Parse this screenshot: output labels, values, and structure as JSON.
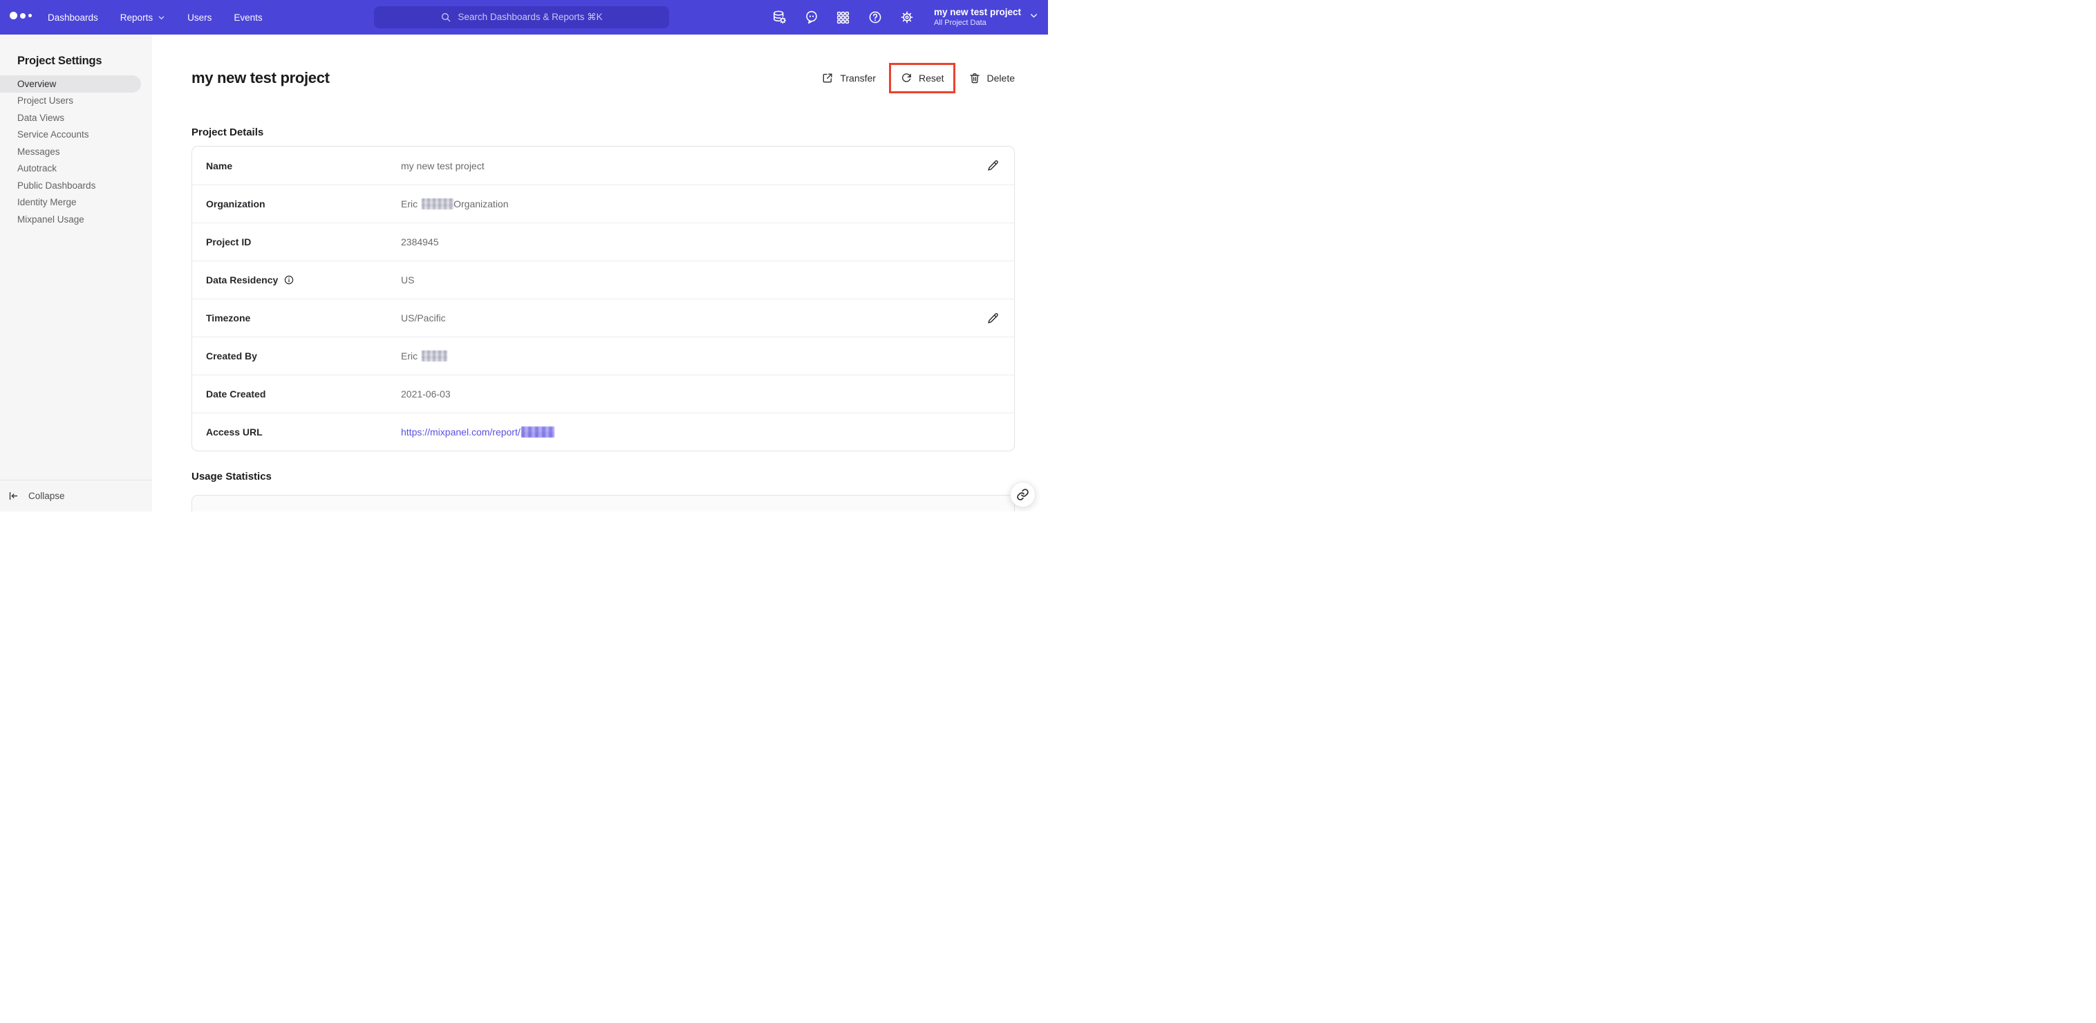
{
  "colors": {
    "nav_background": "#4b44d9",
    "search_background": "#3e37c2",
    "link": "#5a50e0",
    "annotation_red": "#e8432d",
    "sidebar_active_background": "#e5e5e8"
  },
  "nav": {
    "logo": "mixpanel-logo",
    "items": [
      {
        "label": "Dashboards"
      },
      {
        "label": "Reports",
        "chevron": true
      },
      {
        "label": "Users"
      },
      {
        "label": "Events"
      }
    ],
    "search": {
      "placeholder": "Search Dashboards & Reports ⌘K",
      "icon": "search-icon"
    },
    "icon_buttons": [
      {
        "name": "data-management-icon"
      },
      {
        "name": "feedback-icon"
      },
      {
        "name": "apps-grid-icon"
      },
      {
        "name": "help-icon"
      },
      {
        "name": "settings-gear-icon"
      }
    ],
    "project_selector": {
      "name": "my new test project",
      "scope": "All Project Data",
      "chevron": "chevron-down-icon"
    }
  },
  "sidebar": {
    "title": "Project Settings",
    "items": [
      {
        "label": "Overview",
        "active": true
      },
      {
        "label": "Project Users"
      },
      {
        "label": "Data Views"
      },
      {
        "label": "Service Accounts"
      },
      {
        "label": "Messages"
      },
      {
        "label": "Autotrack"
      },
      {
        "label": "Public Dashboards"
      },
      {
        "label": "Identity Merge"
      },
      {
        "label": "Mixpanel Usage"
      }
    ],
    "collapse_label": "Collapse"
  },
  "main": {
    "title": "my new test project",
    "actions": {
      "transfer": {
        "label": "Transfer",
        "icon": "transfer-icon"
      },
      "reset": {
        "label": "Reset",
        "icon": "reset-icon",
        "annotated": true
      },
      "delete": {
        "label": "Delete",
        "icon": "trash-icon"
      }
    },
    "project_details": {
      "title": "Project Details",
      "rows": [
        {
          "label": "Name",
          "value": "my new test project",
          "editable": true
        },
        {
          "label": "Organization",
          "value_prefix": "Eric",
          "value_suffix": "Organization",
          "redacted": true
        },
        {
          "label": "Project ID",
          "value": "2384945"
        },
        {
          "label": "Data Residency",
          "value": "US",
          "info": true
        },
        {
          "label": "Timezone",
          "value": "US/Pacific",
          "editable": true
        },
        {
          "label": "Created By",
          "value_prefix": "Eric",
          "redacted": true
        },
        {
          "label": "Date Created",
          "value": "2021-06-03"
        },
        {
          "label": "Access URL",
          "link_prefix": "https://mixpanel.com/report/",
          "redacted": true
        }
      ]
    },
    "usage_statistics": {
      "title": "Usage Statistics"
    }
  }
}
